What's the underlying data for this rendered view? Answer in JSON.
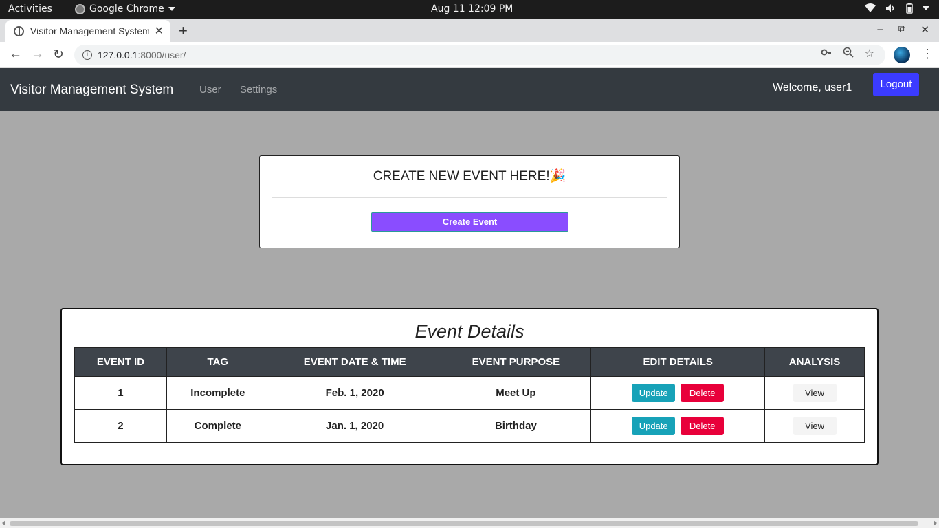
{
  "system_bar": {
    "activities": "Activities",
    "app_name": "Google Chrome",
    "clock": "Aug 11  12:09 PM",
    "tray_icons": [
      "wifi-icon",
      "volume-icon",
      "battery-icon",
      "power-menu-icon"
    ]
  },
  "browser": {
    "tab_title": "Visitor Management System",
    "tab_close": "✕",
    "new_tab": "+",
    "url_host": "127.0.0.1",
    "url_rest": ":8000/user/"
  },
  "navbar": {
    "brand": "Visitor Management System",
    "links": [
      {
        "label": "User"
      },
      {
        "label": "Settings"
      }
    ],
    "welcome": "Welcome, user1",
    "logout_label": "Logout"
  },
  "create_card": {
    "heading": "CREATE NEW EVENT HERE!🎉",
    "button_label": "Create Event"
  },
  "events": {
    "title": "Event Details",
    "columns": [
      "EVENT ID",
      "TAG",
      "EVENT DATE & TIME",
      "EVENT PURPOSE",
      "EDIT DETAILS",
      "ANALYSIS"
    ],
    "rows": [
      {
        "id": "1",
        "tag": "Incomplete",
        "datetime": "Feb. 1, 2020",
        "purpose": "Meet Up",
        "update_label": "Update",
        "delete_label": "Delete",
        "view_label": "View"
      },
      {
        "id": "2",
        "tag": "Complete",
        "datetime": "Jan. 1, 2020",
        "purpose": "Birthday",
        "update_label": "Update",
        "delete_label": "Delete",
        "view_label": "View"
      }
    ]
  },
  "colors": {
    "navbar_bg": "#343a40",
    "page_bg": "#a9a9a9",
    "logout_bg": "#3b3bff",
    "create_button_bg": "#8a4dff",
    "update_bg": "#17a2b8",
    "delete_bg": "#e8003a",
    "table_header_bg": "#3e444b"
  }
}
